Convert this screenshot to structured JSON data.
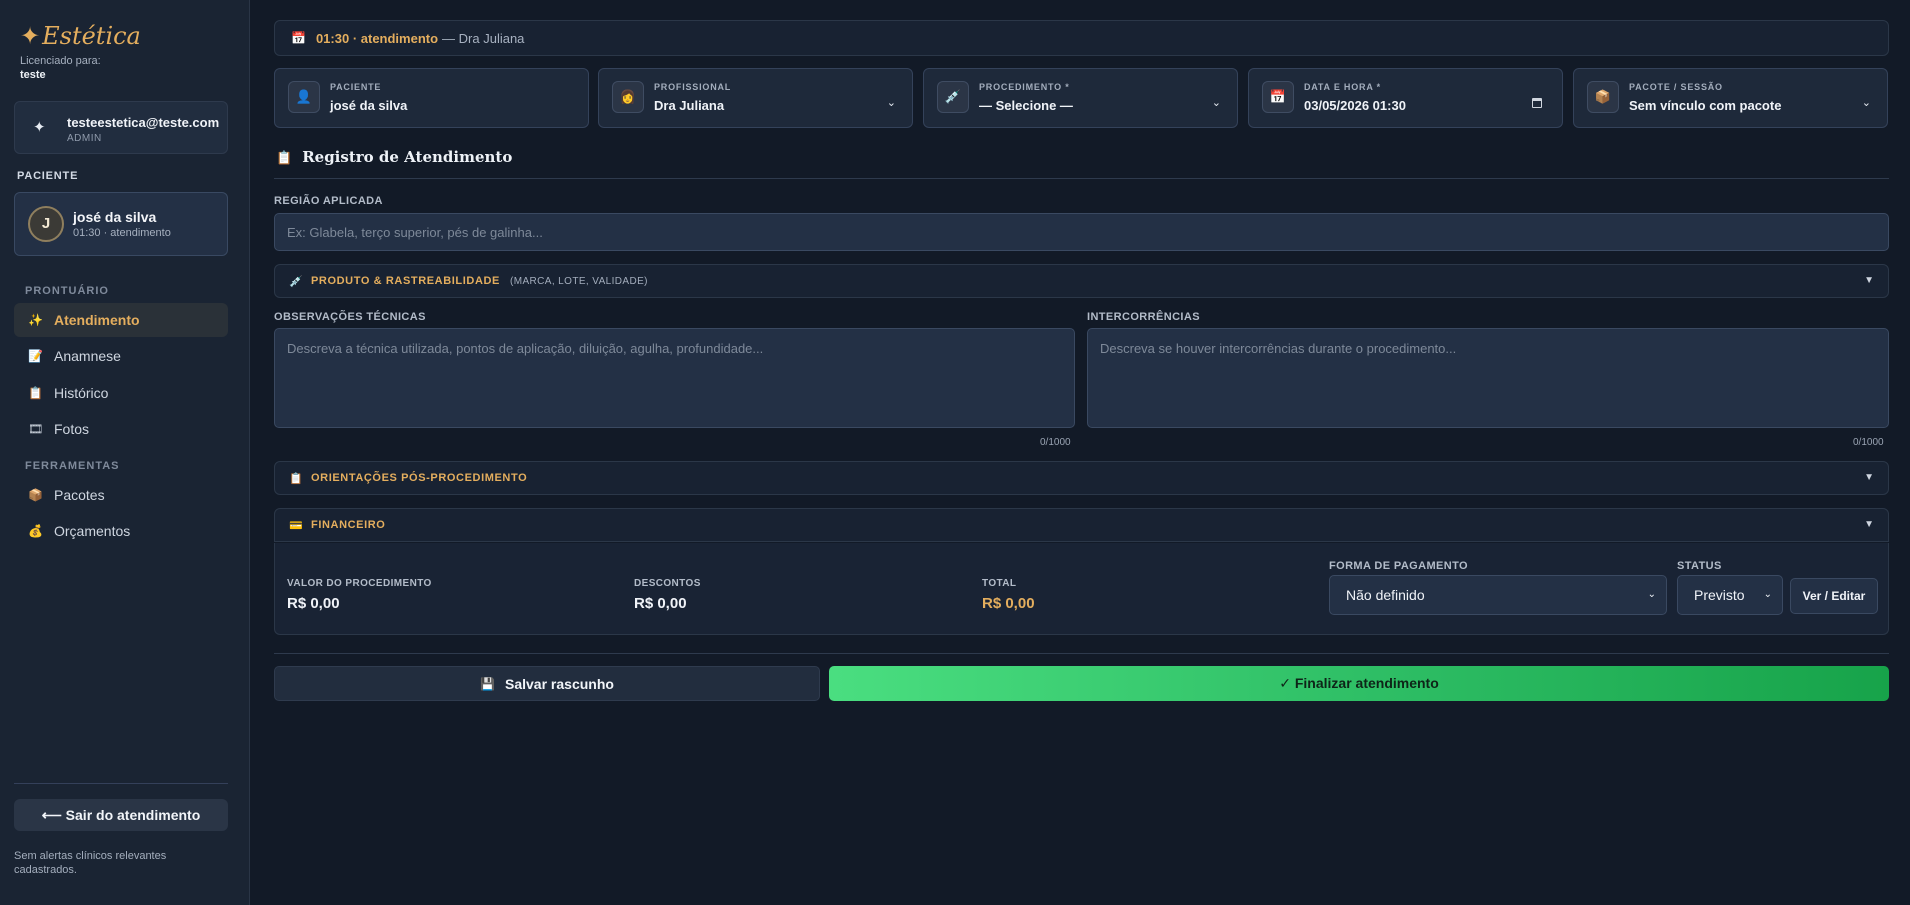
{
  "sidebar": {
    "brand": "Estética",
    "license_label": "Licenciado para:",
    "license_user": "teste",
    "account": {
      "email": "testeestetica@teste.com",
      "role": "ADMIN"
    },
    "patient_section_label": "PACIENTE",
    "patient": {
      "initial": "J",
      "name": "josé da silva",
      "subtitle": "01:30 · atendimento"
    },
    "prontuario_label": "PRONTUÁRIO",
    "prontuario_items": [
      {
        "label": "Atendimento",
        "icon": "sparkles-icon",
        "active": true
      },
      {
        "label": "Anamnese",
        "icon": "document-icon",
        "active": false
      },
      {
        "label": "Histórico",
        "icon": "clipboard-icon",
        "active": false
      },
      {
        "label": "Fotos",
        "icon": "film-icon",
        "active": false
      }
    ],
    "ferramentas_label": "FERRAMENTAS",
    "ferramentas_items": [
      {
        "label": "Pacotes",
        "icon": "package-icon"
      },
      {
        "label": "Orçamentos",
        "icon": "money-bag-icon"
      }
    ],
    "exit_button": "⟵ Sair do atendimento",
    "footer_note": "Sem alertas clínicos relevantes cadastrados."
  },
  "topbar": {
    "time_label": "01:30 · atendimento",
    "professional": "— Dra Juliana"
  },
  "fields": {
    "paciente": {
      "label": "PACIENTE",
      "value": "josé da silva"
    },
    "profissional": {
      "label": "PROFISSIONAL",
      "value": "Dra Juliana"
    },
    "procedimento": {
      "label": "PROCEDIMENTO *",
      "value": "— Selecione —"
    },
    "data_hora": {
      "label": "DATA E HORA *",
      "value": "03/05/2026 01:30"
    },
    "pacote": {
      "label": "PACOTE / SESSÃO",
      "value": "Sem vínculo com pacote"
    }
  },
  "registro": {
    "title": "Registro de Atendimento",
    "regiao_label": "REGIÃO APLICADA",
    "regiao_placeholder": "Ex: Glabela, terço superior, pés de galinha...",
    "produto_title": "PRODUTO & RASTREABILIDADE",
    "produto_sub": "(MARCA, LOTE, VALIDADE)",
    "obs_label": "OBSERVAÇÕES TÉCNICAS",
    "obs_placeholder": "Descreva a técnica utilizada, pontos de aplicação, diluição, agulha, profundidade...",
    "obs_counter": "0/1000",
    "inter_label": "INTERCORRÊNCIAS",
    "inter_placeholder": "Descreva se houver intercorrências durante o procedimento...",
    "inter_counter": "0/1000",
    "orientacoes_title": "ORIENTAÇÕES PÓS-PROCEDIMENTO",
    "financeiro_title": "FINANCEIRO"
  },
  "financeiro": {
    "valor_label": "VALOR DO PROCEDIMENTO",
    "valor": "R$ 0,00",
    "descontos_label": "DESCONTOS",
    "descontos": "R$ 0,00",
    "total_label": "TOTAL",
    "total": "R$ 0,00",
    "pagamento_label": "FORMA DE PAGAMENTO",
    "pagamento": "Não definido",
    "status_label": "STATUS",
    "status": "Previsto",
    "edit_button": "Ver / Editar"
  },
  "actions": {
    "draft": "Salvar rascunho",
    "finish": "✓ Finalizar atendimento"
  },
  "colors": {
    "accent_gold": "#e4ae5e",
    "finish_green": "#2fbf66",
    "background": "#121a27"
  }
}
